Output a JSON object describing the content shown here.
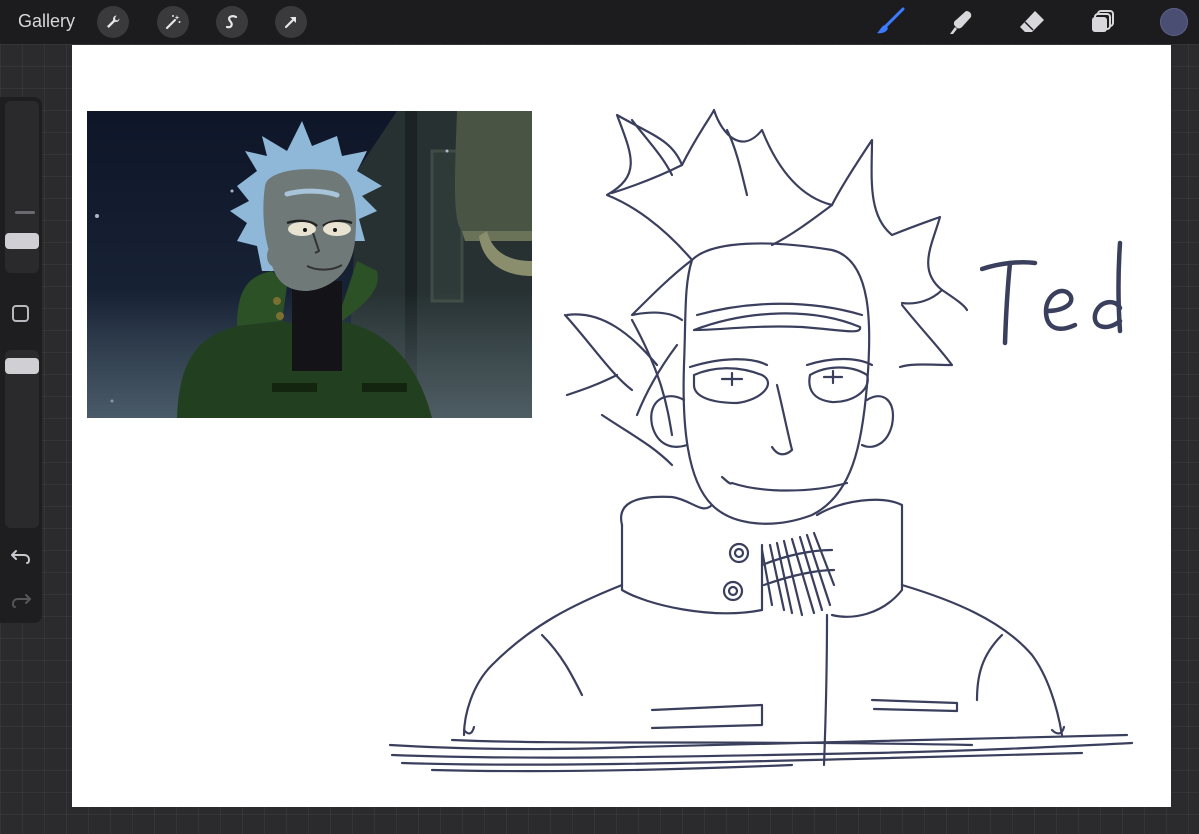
{
  "toolbar": {
    "gallery_label": "Gallery",
    "left_tools": [
      "wrench-icon",
      "magic-wand-icon",
      "selection-s-icon",
      "transform-arrow-icon"
    ],
    "right_tools": [
      "brush-icon",
      "smudge-icon",
      "eraser-icon",
      "layers-icon"
    ],
    "active_tool": "brush",
    "current_color": "#4a4e72",
    "active_tool_color": "#3a7bff"
  },
  "sidebar": {
    "brush_size_level": 0.18,
    "opacity_level": 0.05,
    "items": [
      "brush-size-slider",
      "modify-button",
      "opacity-slider",
      "undo-icon",
      "redo-icon"
    ]
  },
  "canvas": {
    "background": "#ffffff",
    "sketch_label": "Ted",
    "ink_color": "#3b3f5e"
  }
}
